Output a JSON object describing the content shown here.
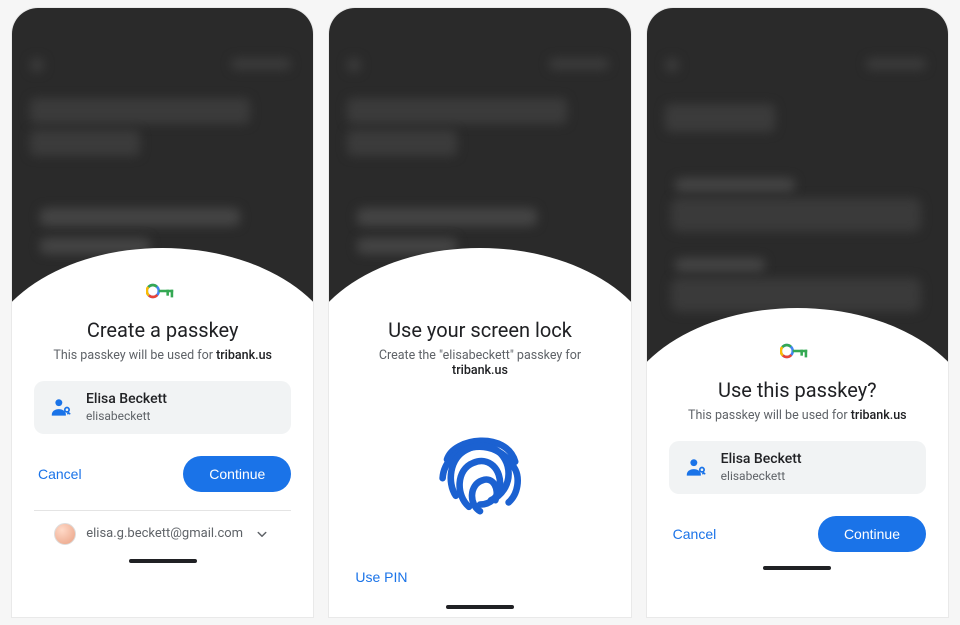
{
  "screens": {
    "create": {
      "title": "Create a passkey",
      "subtitle_prefix": "This passkey will be used for ",
      "subtitle_bold": "tribank.us",
      "account_name": "Elisa Beckett",
      "account_username": "elisabeckett",
      "cancel": "Cancel",
      "continue": "Continue",
      "footer_email": "elisa.g.beckett@gmail.com"
    },
    "lock": {
      "title": "Use your screen lock",
      "subtitle_prefix": "Create the \"elisabeckett\" passkey for ",
      "subtitle_bold": "tribank.us",
      "use_pin": "Use PIN"
    },
    "use": {
      "title": "Use this passkey?",
      "subtitle_prefix": "This passkey will be used for ",
      "subtitle_bold": "tribank.us",
      "account_name": "Elisa Beckett",
      "account_username": "elisabeckett",
      "cancel": "Cancel",
      "continue": "Continue"
    }
  }
}
